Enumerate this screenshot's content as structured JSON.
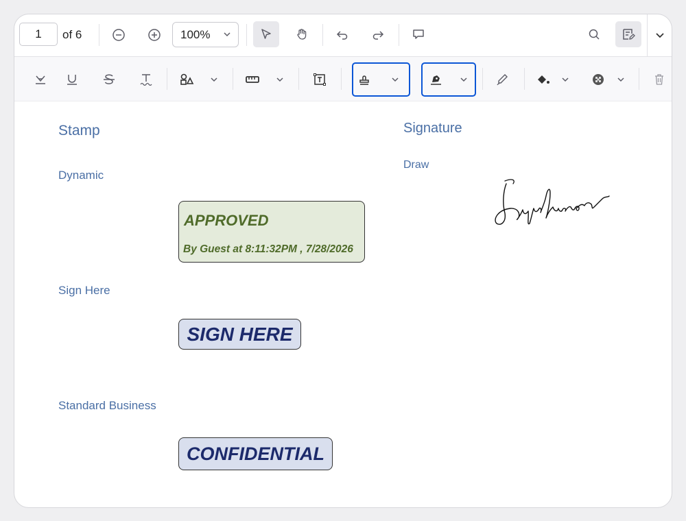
{
  "toolbar": {
    "page_number": "1",
    "page_count": "of 6",
    "zoom": "100%",
    "icons": [
      "zoom-out-icon",
      "zoom-in-icon",
      "select-cursor-icon",
      "pan-hand-icon",
      "undo-icon",
      "redo-icon",
      "comment-icon",
      "search-icon",
      "annotation-edit-icon",
      "more-chevron-icon"
    ]
  },
  "annotation_toolbar": {
    "icons": [
      "highlight-icon",
      "underline-icon",
      "strikethrough-icon",
      "squiggly-icon",
      "shapes-icon",
      "measure-icon",
      "free-text-icon",
      "stamp-icon",
      "signature-icon",
      "ink-icon",
      "fill-color-icon",
      "opacity-icon",
      "delete-icon"
    ],
    "highlight_color": "#0b56d6"
  },
  "document": {
    "stamp_section": {
      "title": "Stamp",
      "dynamic_label": "Dynamic",
      "approved_title": "APPROVED",
      "approved_detail": "By Guest at 8:11:32PM , 7/28/2026",
      "sign_here_label": "Sign Here",
      "sign_here_stamp": "SIGN HERE",
      "business_label": "Standard Business",
      "business_stamp": "CONFIDENTIAL"
    },
    "signature_section": {
      "title": "Signature",
      "draw_label": "Draw"
    }
  }
}
